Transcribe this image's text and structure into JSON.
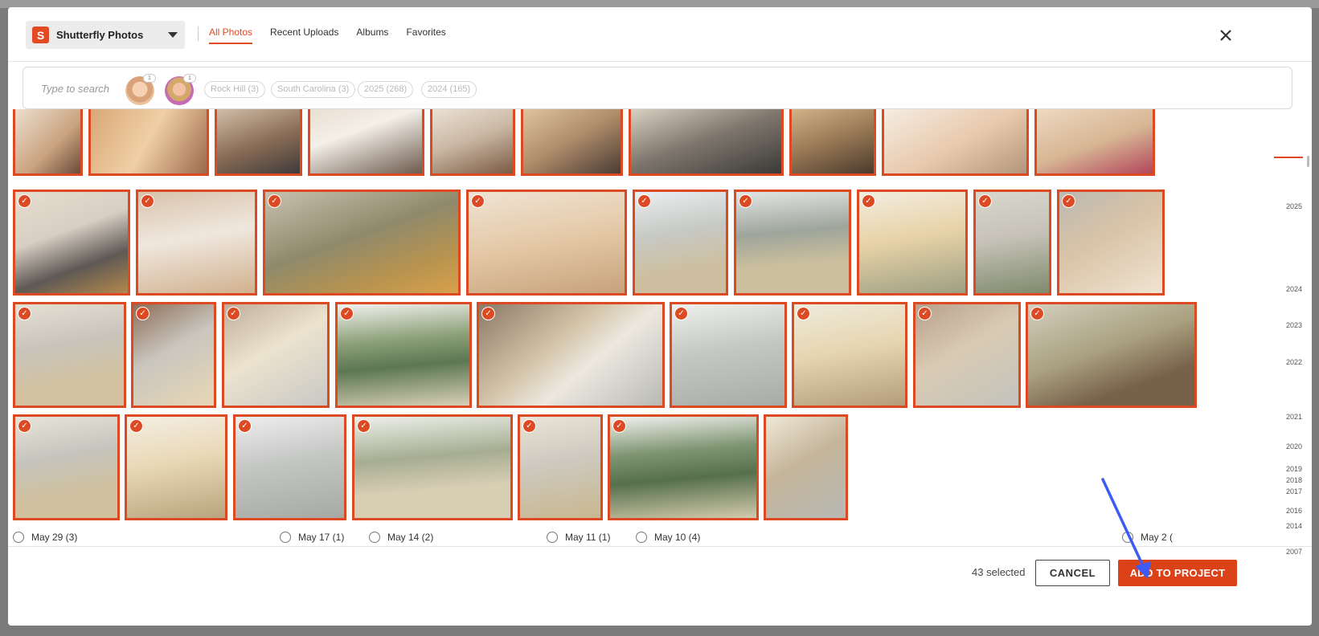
{
  "header": {
    "source_label": "Shutterfly Photos",
    "source_badge": "S",
    "tabs": [
      {
        "label": "All Photos",
        "active": true
      },
      {
        "label": "Recent Uploads",
        "active": false
      },
      {
        "label": "Albums",
        "active": false
      },
      {
        "label": "Favorites",
        "active": false
      }
    ],
    "close_icon": "close-icon"
  },
  "search": {
    "placeholder": "Type to search",
    "faces": [
      {
        "count": "1",
        "color": "#f2c9a3"
      },
      {
        "count": "1",
        "color": "#c96bb5"
      }
    ],
    "chips": [
      "Rock Hill (3)",
      "South Carolina (3)",
      "2025 (268)",
      "2024 (165)"
    ]
  },
  "date_groups": [
    "May 29 (3)",
    "May 17 (1)",
    "May 14 (2)",
    "May 11 (1)",
    "May 10 (4)",
    "May 2 ("
  ],
  "timeline": {
    "years": [
      "2025",
      "2024",
      "2023",
      "2022",
      "2021",
      "2020",
      "2019",
      "2018",
      "2017",
      "2016",
      "2014",
      "2007"
    ]
  },
  "footer": {
    "selected_text": "43 selected",
    "cancel_label": "CANCEL",
    "add_label": "ADD TO PROJECT"
  },
  "colors": {
    "accent": "#dc4a24",
    "selected_border": "#dc4a24"
  }
}
